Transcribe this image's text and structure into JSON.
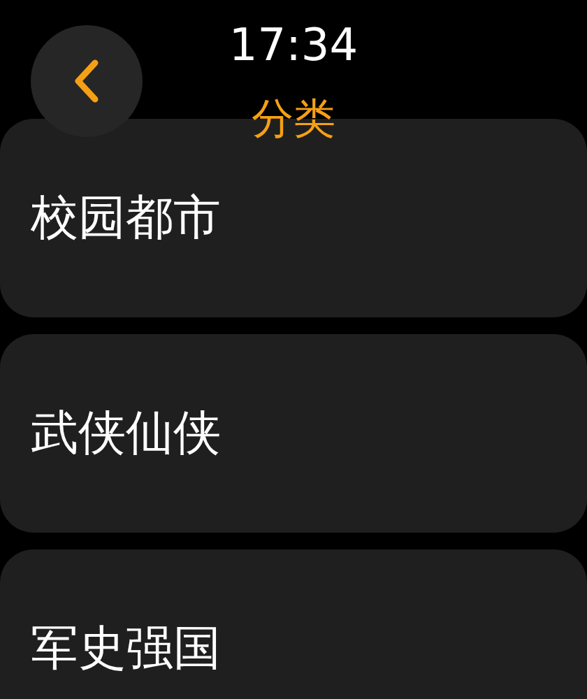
{
  "status_bar": {
    "time": "17:34"
  },
  "header": {
    "back": {
      "kind": "back"
    },
    "title": "分类"
  },
  "categories": [
    {
      "label": "校园都市"
    },
    {
      "label": "武侠仙侠"
    },
    {
      "label": "军史强国"
    }
  ]
}
